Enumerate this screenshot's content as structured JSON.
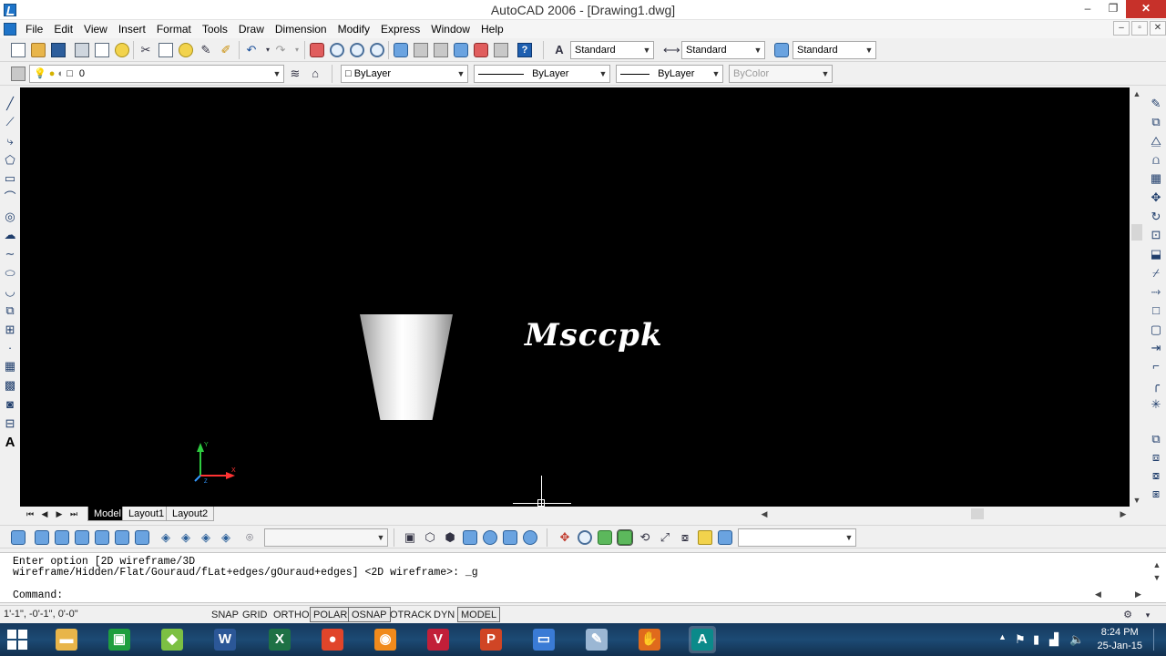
{
  "window": {
    "title": "AutoCAD 2006 - [Drawing1.dwg]",
    "minimize": "–",
    "maximize": "❐",
    "close": "✕"
  },
  "menu": {
    "items": [
      "File",
      "Edit",
      "View",
      "Insert",
      "Format",
      "Tools",
      "Draw",
      "Dimension",
      "Modify",
      "Express",
      "Window",
      "Help"
    ],
    "mdi": [
      "–",
      "▫",
      "✕"
    ]
  },
  "toolbar_standard": {
    "icons": [
      "new-icon",
      "open-icon",
      "save-icon",
      "print-icon",
      "print-preview-icon",
      "publish-icon",
      "cut-icon",
      "copy-icon",
      "paste-icon",
      "match-properties-icon",
      "undo-icon",
      "redo-icon",
      "pan-icon",
      "zoom-realtime-icon",
      "zoom-window-icon",
      "zoom-previous-icon",
      "properties-icon",
      "design-center-icon",
      "tool-palettes-icon",
      "sheet-set-icon",
      "markup-icon",
      "quickcalc-icon",
      "help-icon"
    ],
    "text_style": "Standard",
    "dim_style": "Standard",
    "table_style": "Standard"
  },
  "toolbar_layers": {
    "current_layer": "0",
    "color": "ByLayer",
    "linetype": "ByLayer",
    "lineweight": "ByLayer",
    "plot_style": "ByColor"
  },
  "drawing": {
    "watermark": "Msccpk",
    "ucs": {
      "x": "X",
      "y": "Y",
      "z": "Z"
    }
  },
  "layout_tabs": [
    "Model",
    "Layout1",
    "Layout2"
  ],
  "toolbar_3d": {
    "visual_style_value": "",
    "view_combo_value": ""
  },
  "command": {
    "history_line1": "Enter option [2D wireframe/3D",
    "history_line2": "wireframe/Hidden/Flat/Gouraud/fLat+edges/gOuraud+edges] <2D wireframe>: _g",
    "prompt": "Command:"
  },
  "status": {
    "coordinates": "1'-1\", -0'-1\", 0'-0\"",
    "toggles": [
      {
        "label": "SNAP",
        "on": false
      },
      {
        "label": "GRID",
        "on": false
      },
      {
        "label": "ORTHO",
        "on": false
      },
      {
        "label": "POLAR",
        "on": true
      },
      {
        "label": "OSNAP",
        "on": true
      },
      {
        "label": "OTRACK",
        "on": false
      },
      {
        "label": "DYN",
        "on": false
      },
      {
        "label": "MODEL",
        "on": true
      }
    ]
  },
  "taskbar": {
    "apps": [
      {
        "name": "file-explorer",
        "glyph": "▬",
        "color": "#e8b54a"
      },
      {
        "name": "store",
        "glyph": "▣",
        "color": "#1f9e3e"
      },
      {
        "name": "camtasia",
        "glyph": "◆",
        "color": "#7cc043"
      },
      {
        "name": "word",
        "glyph": "W",
        "color": "#2b5797"
      },
      {
        "name": "excel",
        "glyph": "X",
        "color": "#1e7145"
      },
      {
        "name": "chrome",
        "glyph": "●",
        "color": "#e1452a"
      },
      {
        "name": "media-player",
        "glyph": "◉",
        "color": "#f08a1c"
      },
      {
        "name": "vc",
        "glyph": "V",
        "color": "#c21f39"
      },
      {
        "name": "powerpoint",
        "glyph": "P",
        "color": "#d04525"
      },
      {
        "name": "monitor",
        "glyph": "▭",
        "color": "#3a7bd5"
      },
      {
        "name": "paint",
        "glyph": "✎",
        "color": "#9bb7d4"
      },
      {
        "name": "glove-app",
        "glyph": "✋",
        "color": "#e06a1c"
      },
      {
        "name": "autocad",
        "glyph": "A",
        "color": "#0b8a8a"
      }
    ],
    "time": "8:24 PM",
    "date": "25-Jan-15"
  }
}
